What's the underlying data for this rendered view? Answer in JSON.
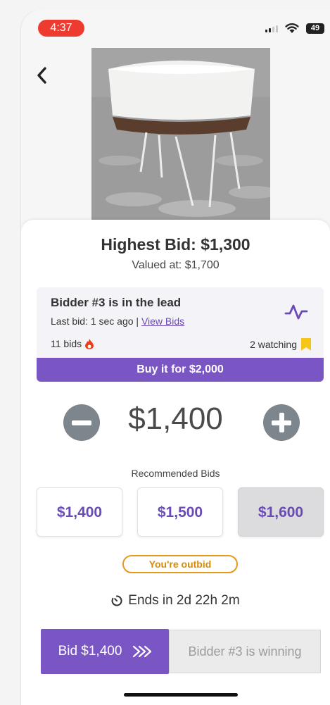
{
  "status_bar": {
    "time": "4:37",
    "battery": "49"
  },
  "product": {
    "image_name": "bassinet-product-image"
  },
  "auction": {
    "highest_bid": "Highest Bid: $1,300",
    "valued_at": "Valued at: $1,700",
    "lead_title": "Bidder #3 is in the lead",
    "last_bid_prefix": "Last bid: 1 sec ago | ",
    "view_bids": "View Bids",
    "bids_count": "11 bids",
    "watching": "2 watching",
    "buy_now": "Buy it for $2,000"
  },
  "stepper": {
    "amount": "$1,400"
  },
  "recommended": {
    "label": "Recommended Bids",
    "bids": [
      "$1,400",
      "$1,500",
      "$1,600"
    ],
    "selected_index": 2
  },
  "status": {
    "outbid": "You're outbid",
    "ends": "Ends in 2d 22h 2m"
  },
  "actions": {
    "bid_label": "Bid $1,400",
    "winning_label": "Bidder #3 is winning"
  },
  "colors": {
    "accent": "#7a55c4",
    "link": "#6a4bb5",
    "warning": "#e69a1c",
    "status_pill": "#ee3b30"
  }
}
